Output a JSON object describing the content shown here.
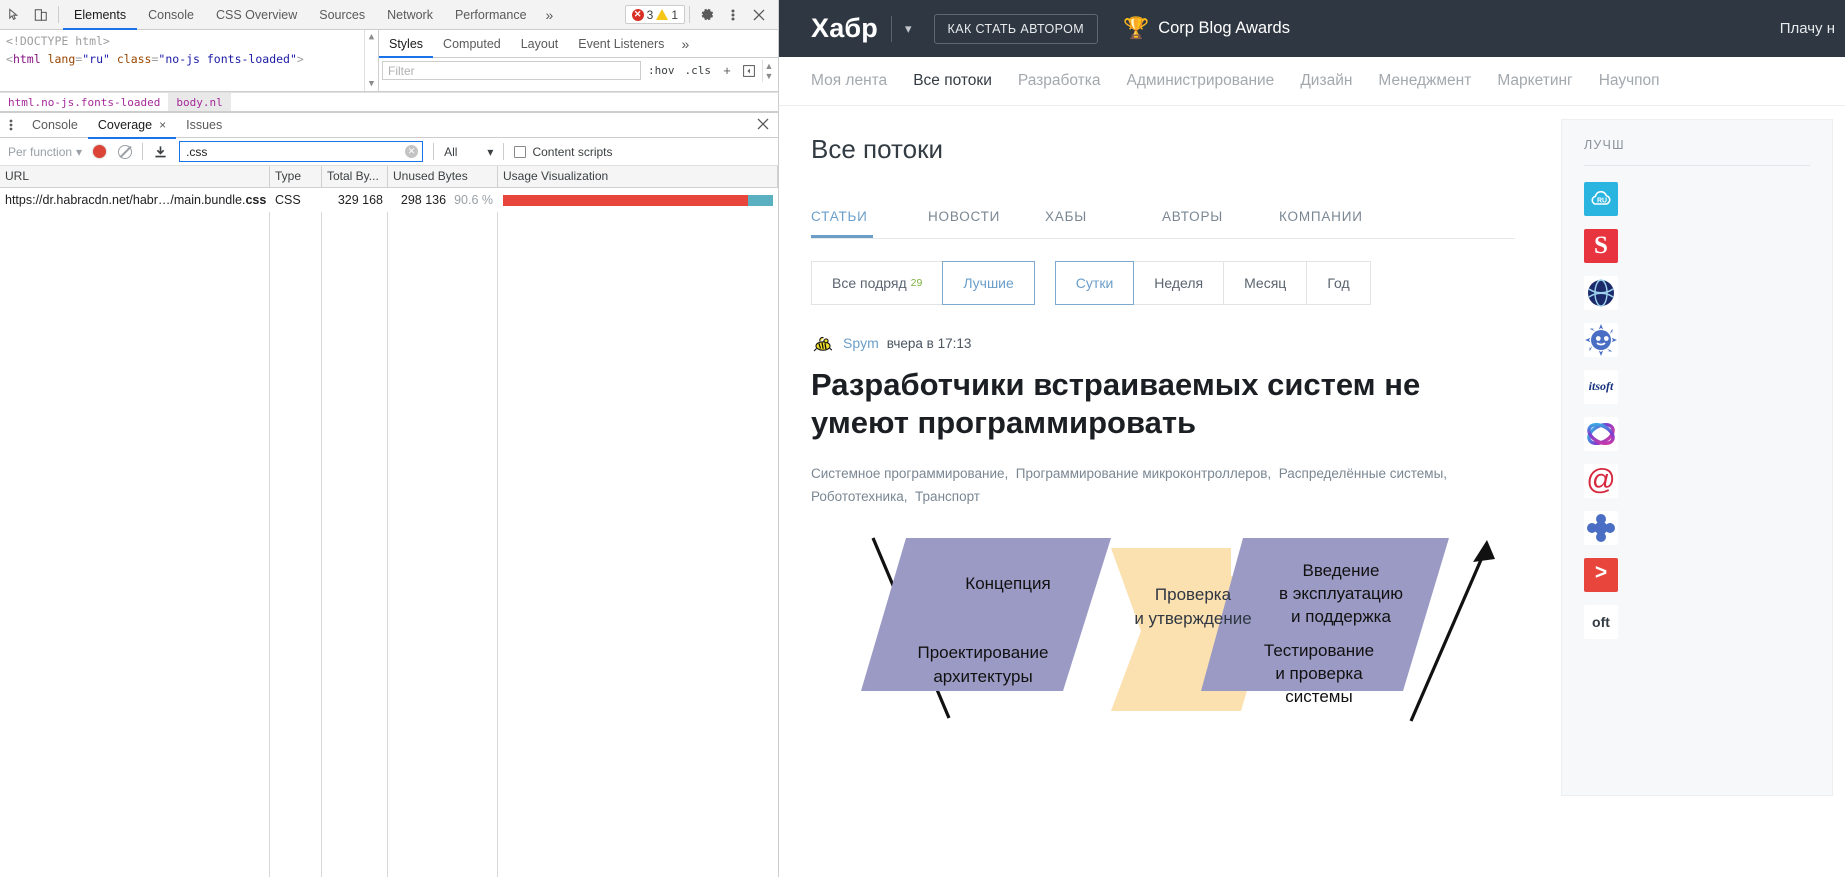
{
  "devtools": {
    "toolbar": {
      "inspect_icon": "inspect-cursor-icon",
      "device_icon": "device-toolbar-icon",
      "tabs": [
        {
          "label": "Elements",
          "active": true
        },
        {
          "label": "Console",
          "active": false
        },
        {
          "label": "CSS Overview",
          "active": false
        },
        {
          "label": "Sources",
          "active": false
        },
        {
          "label": "Network",
          "active": false
        },
        {
          "label": "Performance",
          "active": false
        }
      ],
      "more_tabs": "»",
      "error_count": "3",
      "warning_count": "1",
      "settings_icon": "gear-icon",
      "menu_icon": "kebab-menu-icon",
      "close_icon": "close-icon"
    },
    "dom": {
      "line1": "<!DOCTYPE html>",
      "line2_open": "<",
      "line2_tag": "html",
      "line2_attr1": "lang",
      "line2_eq": "=",
      "line2_val1": "\"ru\"",
      "line2_attr2": "class",
      "line2_val2": "\"no-js fonts-loaded\"",
      "line2_close": ">"
    },
    "breadcrumbs": [
      {
        "label": "html.no-js.fonts-loaded",
        "selected": false
      },
      {
        "label": "body.nl",
        "selected": true
      }
    ],
    "styles": {
      "tabs": [
        {
          "label": "Styles",
          "active": true
        },
        {
          "label": "Computed",
          "active": false
        },
        {
          "label": "Layout",
          "active": false
        },
        {
          "label": "Event Listeners",
          "active": false
        }
      ],
      "more": "»",
      "filter_placeholder": "Filter",
      "hov": ":hov",
      "cls": ".cls",
      "plus": "+",
      "newstyle": "new-style-rule-icon"
    },
    "drawer": {
      "kebab": "kebab-menu-icon",
      "tabs": [
        {
          "label": "Console",
          "active": false,
          "closable": false
        },
        {
          "label": "Coverage",
          "active": true,
          "closable": true
        },
        {
          "label": "Issues",
          "active": false,
          "closable": false
        }
      ],
      "close_label": "×",
      "panel_close": "×"
    },
    "coverage": {
      "mode_label": "Per function",
      "record_icon": "record-button",
      "clear_icon": "clear-icon",
      "export_icon": "download-icon",
      "filter_value": ".css",
      "filter_clear": "clear-input-icon",
      "type_filter": "All",
      "content_scripts_label": "Content scripts",
      "content_scripts_checked": false,
      "columns": [
        "URL",
        "Type",
        "Total By...",
        "Unused Bytes",
        "Usage Visualization"
      ],
      "rows": [
        {
          "url_prefix": "https://dr.habracdn.net/habr…/main.bundle.",
          "url_bold": "css",
          "type": "CSS",
          "total_bytes": "329 168",
          "unused_bytes": "298 136",
          "unused_pct": "90.6 %",
          "used_color": "#e8453c",
          "unused_color": "#5aafc0",
          "used_fraction": 0.906
        }
      ]
    }
  },
  "habr": {
    "header": {
      "logo": "Хабр",
      "chevron": "chevron-down-icon",
      "author_button": "КАК СТАТЬ АВТОРОМ",
      "trophy_icon": "trophy-icon",
      "corp_blog": "Corp Blog Awards",
      "pay_link": "Плачу н",
      "bg_color": "#2f3742"
    },
    "nav": [
      {
        "label": "Моя лента",
        "active": false
      },
      {
        "label": "Все потоки",
        "active": true
      },
      {
        "label": "Разработка",
        "active": false
      },
      {
        "label": "Администрирование",
        "active": false
      },
      {
        "label": "Дизайн",
        "active": false
      },
      {
        "label": "Менеджмент",
        "active": false
      },
      {
        "label": "Маркетинг",
        "active": false
      },
      {
        "label": "Научпоп",
        "active": false
      }
    ],
    "page_title": "Все потоки",
    "section_tabs": [
      {
        "label": "СТАТЬИ",
        "active": true
      },
      {
        "label": "НОВОСТИ",
        "active": false
      },
      {
        "label": "ХАБЫ",
        "active": false
      },
      {
        "label": "АВТОРЫ",
        "active": false
      },
      {
        "label": "КОМПАНИИ",
        "active": false
      }
    ],
    "filters": [
      {
        "label": "Все подряд",
        "badge": "29",
        "selected": false
      },
      {
        "label": "Лучшие",
        "badge": "",
        "selected": true
      },
      {
        "label": "Сутки",
        "badge": "",
        "selected": true
      },
      {
        "label": "Неделя",
        "badge": "",
        "selected": false
      },
      {
        "label": "Месяц",
        "badge": "",
        "selected": false
      },
      {
        "label": "Год",
        "badge": "",
        "selected": false
      }
    ],
    "post": {
      "avatar_icon": "user-avatar-bee",
      "author": "Spym",
      "time": "вчера в 17:13",
      "title": "Разработчики встраиваемых систем не умеют программировать",
      "tags": "Системное программирование,  Программирование микроконтроллеров,  Распределённые системы,  Робототехника,  Транспорт",
      "diagram": {
        "title": "v-model-diagram",
        "boxes": [
          {
            "text": "Концепция",
            "color": "#9a9ac4"
          },
          {
            "text": "Проектирование архитектуры",
            "color": "#9a9ac4"
          },
          {
            "text": "Проверка и утверждение",
            "color": "#fbe0b0"
          },
          {
            "text": "Введение в эксплуатацию и поддержка",
            "color": "#9a9ac4"
          },
          {
            "text": "Тестирование и проверка системы",
            "color": "#9a9ac4"
          }
        ]
      }
    },
    "sidebar": {
      "title": "ЛУЧШ",
      "items": [
        {
          "name": "cloud-ru-logo",
          "text": "RU",
          "bg": "#2ab4e0",
          "fg": "#ffffff"
        },
        {
          "name": "skillbox-logo",
          "text": "S",
          "bg": "#e8343f",
          "fg": "#ffffff"
        },
        {
          "name": "dark-blue-globe-logo",
          "text": "",
          "bg": "#ffffff",
          "fg": "#1b2a6b"
        },
        {
          "name": "blue-sun-logo",
          "text": "",
          "bg": "#ffffff",
          "fg": "#4a6ec4"
        },
        {
          "name": "itsoft-logo",
          "text": "itsoft",
          "bg": "#ffffff",
          "fg": "#15317e"
        },
        {
          "name": "gradient-sphere-logo",
          "text": "",
          "bg": "#ffffff",
          "fg": "#8a2fd1"
        },
        {
          "name": "mailru-logo",
          "text": "@",
          "bg": "#ffffff",
          "fg": "#d6293e"
        },
        {
          "name": "blue-flower-logo",
          "text": "",
          "bg": "#ffffff",
          "fg": "#4a6ec4"
        },
        {
          "name": "terminal-prompt-logo",
          "text": ">",
          "bg": "#e8453c",
          "fg": "#ffffff"
        },
        {
          "name": "soft-logo",
          "text": "oft",
          "bg": "#ffffff",
          "fg": "#333b43"
        }
      ]
    }
  }
}
